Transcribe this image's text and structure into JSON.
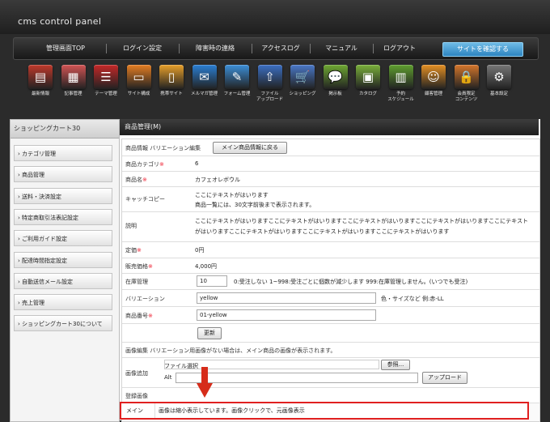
{
  "header": {
    "app_title": "cms control panel"
  },
  "nav": {
    "items": [
      "管理画面TOP",
      "ログイン設定",
      "障害時の連絡",
      "アクセスログ",
      "マニュアル",
      "ログアウト"
    ],
    "site_button": "サイトを確認する"
  },
  "icons": [
    {
      "label": "最新情報",
      "icon": "news-icon",
      "color": "#c0392b",
      "glyph": "▤"
    },
    {
      "label": "記事管理",
      "icon": "articles-icon",
      "color": "#d35454",
      "glyph": "▦"
    },
    {
      "label": "テーマ管理",
      "icon": "list-icon",
      "color": "#c62828",
      "glyph": "☰"
    },
    {
      "label": "サイト構成",
      "icon": "monitor-icon",
      "color": "#e67e22",
      "glyph": "▭"
    },
    {
      "label": "携帯サイト",
      "icon": "mobile-icon",
      "color": "#e8a02a",
      "glyph": "▯"
    },
    {
      "label": "メルマガ管理",
      "icon": "mail-icon",
      "color": "#2a7fd4",
      "glyph": "✉"
    },
    {
      "label": "フォーム管理",
      "icon": "form-icon",
      "color": "#3c8fd8",
      "glyph": "✎"
    },
    {
      "label": "ファイル\nアップロード",
      "icon": "upload-icon",
      "color": "#3b6fc4",
      "glyph": "⇧"
    },
    {
      "label": "ショッピング",
      "icon": "cart-icon",
      "color": "#4a78c8",
      "glyph": "🛒"
    },
    {
      "label": "掲示板",
      "icon": "chat-icon",
      "color": "#6ea832",
      "glyph": "💬"
    },
    {
      "label": "カタログ",
      "icon": "catalog-icon",
      "color": "#7ab03a",
      "glyph": "▣"
    },
    {
      "label": "予約\nスケジュール",
      "icon": "calendar-icon",
      "color": "#5f9f2f",
      "glyph": "▥"
    },
    {
      "label": "顧客管理",
      "icon": "customers-icon",
      "color": "#e59023",
      "glyph": "☺"
    },
    {
      "label": "会員限定\nコンテンツ",
      "icon": "member-lock-icon",
      "color": "#d5762b",
      "glyph": "🔒"
    },
    {
      "label": "基本設定",
      "icon": "gear-icon",
      "color": "#777777",
      "glyph": "⚙"
    }
  ],
  "sidebar": {
    "title": "ショッピングカート30",
    "items": [
      "カテゴリ管理",
      "商品管理",
      "送料・決済設定",
      "特定商取引法表記設定",
      "ご利用ガイド設定",
      "配達時間指定設定",
      "自動送信メール設定",
      "売上管理",
      "ショッピングカート30について"
    ]
  },
  "main": {
    "header": "商品管理(M)",
    "top_label": "商品情報 バリエーション編集",
    "back_button": "メイン商品情報に戻る",
    "fields": {
      "category": {
        "label": "商品カテゴリ",
        "required": "※",
        "value": "6"
      },
      "name": {
        "label": "商品名",
        "required": "※",
        "value": "カフェオレボウル"
      },
      "catch": {
        "label": "キャッチコピー",
        "line1": "ここにテキストがはいります",
        "line2": "商品一覧には、30文字前後まで表示されます。"
      },
      "desc": {
        "label": "説明",
        "line1": "ここにテキストがはいりますここにテキストがはいりますここにテキストがはいりますここにテキストがはいりますここにテキスト",
        "line2": "がはいりますここにテキストがはいりますここにテキストがはいりますここにテキストがはいります"
      },
      "list_price": {
        "label": "定価",
        "required": "※",
        "value": "0円"
      },
      "sale_price": {
        "label": "販売価格",
        "required": "※",
        "value": "4,000円"
      },
      "stock": {
        "label": "在庫管理",
        "value": "10",
        "note": "0:受注しない 1~998:受注ごとに個数が減少します 999:在庫管理しません。(いつでも受注)"
      },
      "variation": {
        "label": "バリエーション",
        "value": "yellow",
        "note": "色・サイズなど 例:赤-LL"
      },
      "code": {
        "label": "商品番号",
        "required": "※",
        "value": "01-yellow"
      }
    },
    "update_button": "更新",
    "image_section_text": "画像編集 バリエーション用画像がない場合は、メイン商品の画像が表示されます。",
    "image_add": {
      "label": "画像追加",
      "file_label": "ファイル選択",
      "browse_button": "参照...",
      "alt_label": "Alt",
      "upload_button": "アップロード"
    },
    "registered_label": "登録画像",
    "main_row": {
      "label": "メイン",
      "text": "画像は縮小表示しています。画像クリックで、元画像表示"
    }
  },
  "colors": {
    "required": "#e22233",
    "highlight_border": "#e02020",
    "arrow": "#d62c1a"
  }
}
